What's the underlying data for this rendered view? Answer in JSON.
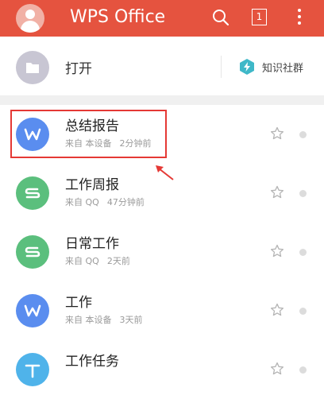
{
  "app": {
    "title": "WPS Office",
    "tab_count": "1",
    "brand_color": "#e5533f"
  },
  "open_row": {
    "label": "打开",
    "community_label": "知识社群"
  },
  "files": [
    {
      "name": "总结报告",
      "source": "来自 本设备",
      "time": "2分钟前",
      "icon": "W",
      "color": "#5a8def",
      "highlighted": true
    },
    {
      "name": "工作周报",
      "source": "来自 QQ",
      "time": "47分钟前",
      "icon": "S",
      "color": "#5bbf7d",
      "highlighted": false
    },
    {
      "name": "日常工作",
      "source": "来自 QQ",
      "time": "2天前",
      "icon": "S",
      "color": "#5bbf7d",
      "highlighted": false
    },
    {
      "name": "工作",
      "source": "来自 本设备",
      "time": "3天前",
      "icon": "W",
      "color": "#5a8def",
      "highlighted": false
    },
    {
      "name": "工作任务",
      "source": "",
      "time": "",
      "icon": "T",
      "color": "#4fb3ea",
      "highlighted": false
    }
  ]
}
